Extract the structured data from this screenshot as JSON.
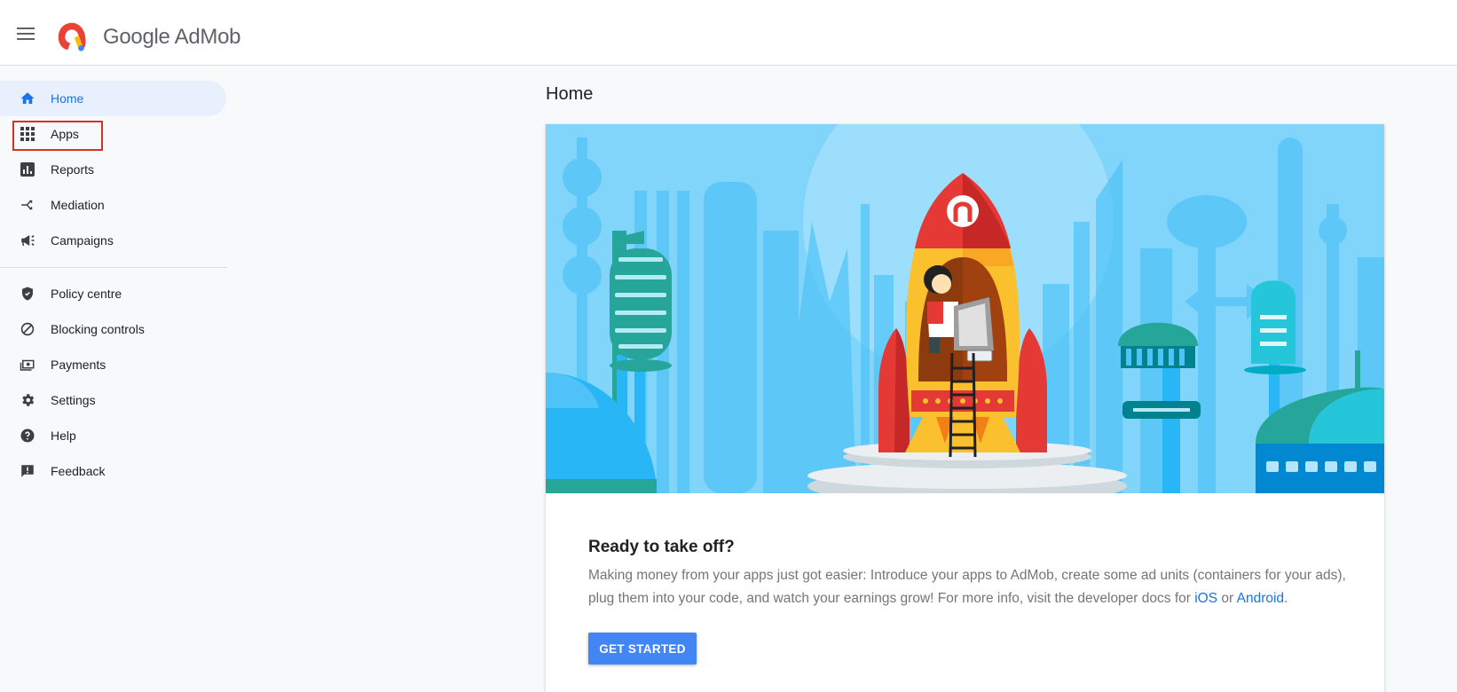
{
  "brand": {
    "google": "Google",
    "product": "AdMob"
  },
  "nav": {
    "main": [
      {
        "id": "home",
        "label": "Home",
        "icon": "home-icon",
        "active": true
      },
      {
        "id": "apps",
        "label": "Apps",
        "icon": "grid-icon",
        "active": false
      },
      {
        "id": "reports",
        "label": "Reports",
        "icon": "bar-chart-icon",
        "active": false
      },
      {
        "id": "mediation",
        "label": "Mediation",
        "icon": "merge-icon",
        "active": false
      },
      {
        "id": "campaigns",
        "label": "Campaigns",
        "icon": "megaphone-icon",
        "active": false
      }
    ],
    "secondary": [
      {
        "id": "policy",
        "label": "Policy centre",
        "icon": "shield-icon"
      },
      {
        "id": "blocking",
        "label": "Blocking controls",
        "icon": "block-icon"
      },
      {
        "id": "payments",
        "label": "Payments",
        "icon": "money-icon"
      },
      {
        "id": "settings",
        "label": "Settings",
        "icon": "gear-icon"
      },
      {
        "id": "help",
        "label": "Help",
        "icon": "help-icon"
      },
      {
        "id": "feedback",
        "label": "Feedback",
        "icon": "feedback-icon"
      }
    ]
  },
  "main": {
    "title": "Home",
    "card": {
      "heading": "Ready to take off?",
      "text_before": "Making money from your apps just got easier: Introduce your apps to AdMob, create some ad units (containers for your ads), plug them into your code, and watch your earnings grow! For more info, visit the developer docs for ",
      "link_ios": "iOS",
      "text_between": " or ",
      "link_android": "Android",
      "text_after": ".",
      "button": "GET STARTED"
    }
  },
  "colors": {
    "accent": "#1a73e8",
    "button": "#4285f4",
    "active_bg": "#e8f0fe",
    "highlight": "#d93025"
  }
}
